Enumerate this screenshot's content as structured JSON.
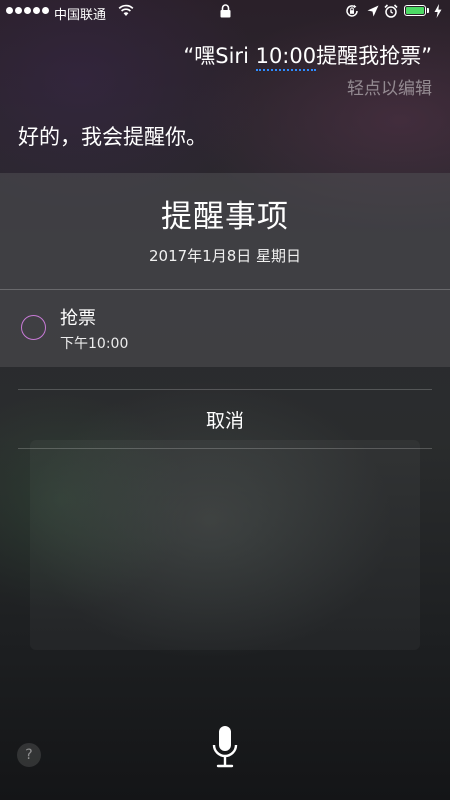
{
  "status_bar": {
    "carrier": "中国联通"
  },
  "siri": {
    "query_prefix": "“嘿Siri ",
    "query_time": "10:00",
    "query_suffix": "提醒我抢票”",
    "tap_to_edit": "轻点以编辑",
    "response": "好的，我会提醒你。"
  },
  "card": {
    "title": "提醒事项",
    "date": "2017年1月8日 星期日",
    "reminder": {
      "title": "抢票",
      "time": "下午10:00"
    }
  },
  "actions": {
    "cancel": "取消",
    "help": "?"
  },
  "icons": {
    "status": [
      "signal-icon",
      "wifi-icon",
      "lock-icon",
      "rotation-lock-icon",
      "location-icon",
      "alarm-icon",
      "battery-icon",
      "charging-icon"
    ],
    "bottom": [
      "help-icon",
      "microphone-icon"
    ]
  },
  "colors": {
    "battery": "#4cd964",
    "reminder_circle": "#c77ad6",
    "edit_underline": "#2f8bff"
  }
}
